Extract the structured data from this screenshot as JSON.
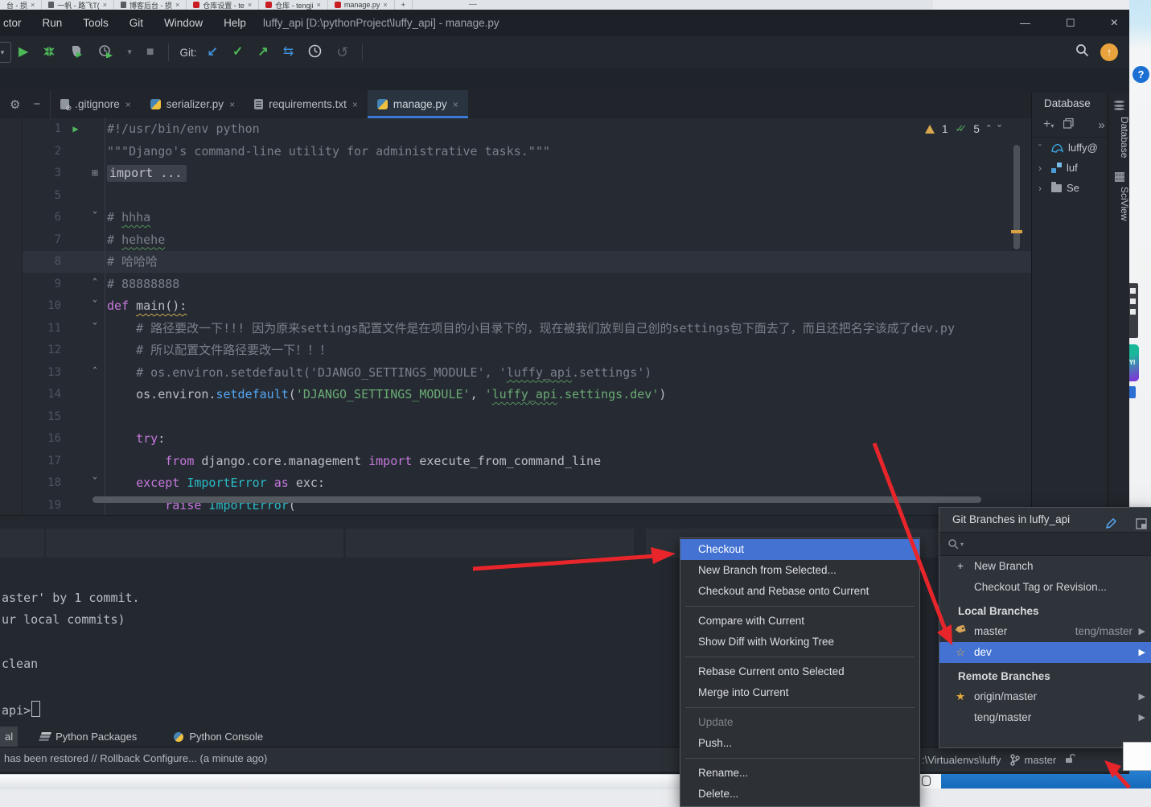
{
  "colors": {
    "selection_blue": "#4372d3",
    "arrow_red": "#e8252a",
    "editor_bg": "#262b33",
    "keyword": "#c678dd",
    "string": "#6aab73",
    "method": "#56a8f5",
    "class": "#2bbac5",
    "comment": "#7a8089",
    "tab_underline": "#3c78d8",
    "gitee_red": "#c71d23"
  },
  "browser": {
    "tabs": [
      {
        "label": "台 - 损",
        "icon": "none"
      },
      {
        "label": "一帆 - 路飞T(",
        "icon": "dark"
      },
      {
        "label": "博客后台 - 损",
        "icon": "dark"
      },
      {
        "label": "仓库设置 - te",
        "icon": "gitee"
      },
      {
        "label": "仓库 - tengji",
        "icon": "gitee"
      },
      {
        "label": "manage.py",
        "icon": "gitee"
      }
    ],
    "close_glyph": "×",
    "new_tab_glyph": "+",
    "minimize_glyph": "—"
  },
  "title_bar": {
    "menus": [
      "ctor",
      "Run",
      "Tools",
      "Git",
      "Window",
      "Help"
    ],
    "title": "luffy_api [D:\\pythonProject\\luffy_api] - manage.py",
    "controls": {
      "minimize": "—",
      "maximize": "☐",
      "close": "×"
    }
  },
  "toolbar": {
    "git_label": "Git:",
    "run_config_caret": "▾",
    "play": "▶",
    "dropdown": "▾",
    "stop": "■",
    "update": "↙",
    "commit": "✓",
    "push": "↗",
    "compare": "⇆",
    "rollback": "↺",
    "up_arrow": "↑"
  },
  "editor": {
    "tabs": [
      {
        "label": ".gitignore",
        "icon": "doc-slash"
      },
      {
        "label": "serializer.py",
        "icon": "python"
      },
      {
        "label": "requirements.txt",
        "icon": "doc-txt"
      },
      {
        "label": "manage.py",
        "icon": "python"
      }
    ],
    "active_tab": "manage.py",
    "inspections": {
      "warnings": "1",
      "typos": "5",
      "prev": "ˆ",
      "next": "ˇ"
    },
    "lines": [
      {
        "n": "1",
        "g": "run",
        "t": [
          [
            "c",
            "#!/usr/bin/env python"
          ]
        ]
      },
      {
        "n": "2",
        "g": "",
        "t": [
          [
            "c",
            "\"\"\"Django's command-line utility for administrative tasks.\"\"\""
          ]
        ]
      },
      {
        "n": "3",
        "g": "plus",
        "t": [
          [
            "f",
            "import ..."
          ]
        ]
      },
      {
        "n": "5",
        "g": "",
        "t": []
      },
      {
        "n": "6",
        "g": "fo",
        "t": [
          [
            "c",
            "# "
          ],
          [
            "c wg",
            "hhha"
          ]
        ]
      },
      {
        "n": "7",
        "g": "",
        "t": [
          [
            "c",
            "# "
          ],
          [
            "c wg",
            "hehehe"
          ]
        ]
      },
      {
        "n": "8",
        "g": "",
        "cur": true,
        "t": [
          [
            "c",
            "# 哈哈哈"
          ]
        ]
      },
      {
        "n": "9",
        "g": "fe",
        "t": [
          [
            "c",
            "# 88888888"
          ]
        ]
      },
      {
        "n": "10",
        "g": "fo",
        "t": [
          [
            "k",
            "def "
          ],
          [
            "p wy",
            "main():"
          ]
        ]
      },
      {
        "n": "11",
        "g": "fo",
        "t": [
          [
            "c",
            "    # 路径要改一下!!! 因为原来settings配置文件是在项目的小目录下的，现在被我们放到自己创的settings包下面去了，而且还把名字该成了dev.py"
          ]
        ]
      },
      {
        "n": "12",
        "g": "",
        "t": [
          [
            "c",
            "    # 所以配置文件路径要改一下！！！"
          ]
        ]
      },
      {
        "n": "13",
        "g": "fe",
        "t": [
          [
            "c",
            "    # os.environ.setdefault('DJANGO_SETTINGS_MODULE', '"
          ],
          [
            "c wg",
            "luffy_api"
          ],
          [
            "c",
            ".settings')"
          ]
        ]
      },
      {
        "n": "14",
        "g": "",
        "t": [
          [
            "p",
            "    os.environ."
          ],
          [
            "m",
            "setdefault"
          ],
          [
            "p",
            "("
          ],
          [
            "s",
            "'DJANGO_SETTINGS_MODULE'"
          ],
          [
            "p",
            ", "
          ],
          [
            "s",
            "'"
          ],
          [
            "s wg",
            "luffy_api"
          ],
          [
            "s",
            ".settings.dev'"
          ],
          [
            "p",
            ")"
          ]
        ]
      },
      {
        "n": "15",
        "g": "",
        "t": []
      },
      {
        "n": "16",
        "g": "",
        "t": [
          [
            "k",
            "    try"
          ],
          [
            "p",
            ":"
          ]
        ]
      },
      {
        "n": "17",
        "g": "",
        "t": [
          [
            "k",
            "        from "
          ],
          [
            "p",
            "django.core.management "
          ],
          [
            "k",
            "import "
          ],
          [
            "p",
            "execute_from_command_line"
          ]
        ]
      },
      {
        "n": "18",
        "g": "fo",
        "t": [
          [
            "k",
            "    except "
          ],
          [
            "cl",
            "ImportError "
          ],
          [
            "k",
            "as "
          ],
          [
            "p",
            "exc:"
          ]
        ]
      },
      {
        "n": "19",
        "g": "",
        "t": [
          [
            "k",
            "        raise "
          ],
          [
            "cl",
            "ImportError"
          ],
          [
            "p",
            "("
          ]
        ]
      }
    ]
  },
  "database": {
    "title": "Database",
    "toolbar": {
      "add": "+",
      "caret": "▾",
      "more": "»"
    },
    "tree": [
      {
        "label": "luffy@",
        "icon": "mysql",
        "chevron": "expanded"
      },
      {
        "label": "luf",
        "icon": "schema",
        "chevron": "collapsed"
      },
      {
        "label": "Se",
        "icon": "folder",
        "chevron": "collapsed"
      }
    ]
  },
  "stripe_labels": {
    "database": "Database",
    "sciview": "SciView"
  },
  "terminal": {
    "lines": [
      "aster' by 1 commit.",
      "ur local commits)",
      "clean",
      "api>"
    ]
  },
  "bottom_tabs": [
    {
      "label": "al",
      "icon": "terminal",
      "selected": true
    },
    {
      "label": "Python Packages",
      "icon": "layers",
      "selected": false
    },
    {
      "label": "Python Console",
      "icon": "python",
      "selected": false
    }
  ],
  "status_bar": {
    "left": "has been restored // Rollback   Configure... (a minute ago)",
    "path": ":\\Virtualenvs\\luffy",
    "branch": "master"
  },
  "git_popup": {
    "title": "Git Branches in luffy_api",
    "rows": [
      {
        "t": "action",
        "icon": "plus",
        "label": "New Branch"
      },
      {
        "t": "action",
        "icon": "",
        "label": "Checkout Tag or Revision..."
      },
      {
        "t": "header",
        "label": "Local Branches"
      },
      {
        "t": "branch",
        "icon": "tag",
        "label": "master",
        "right": "teng/master",
        "arrow": true
      },
      {
        "t": "branch",
        "icon": "star-o",
        "label": "dev",
        "sel": true,
        "arrow": true
      },
      {
        "t": "header",
        "label": "Remote Branches"
      },
      {
        "t": "branch",
        "icon": "star",
        "label": "origin/master",
        "arrow": true
      },
      {
        "t": "branch",
        "icon": "",
        "label": "teng/master",
        "arrow": true
      }
    ]
  },
  "context_menu": {
    "items": [
      {
        "label": "Checkout",
        "sel": true
      },
      {
        "label": "New Branch from Selected..."
      },
      {
        "label": "Checkout and Rebase onto Current"
      },
      {
        "sep": true
      },
      {
        "label": "Compare with Current"
      },
      {
        "label": "Show Diff with Working Tree"
      },
      {
        "sep": true
      },
      {
        "label": "Rebase Current onto Selected"
      },
      {
        "label": "Merge into Current"
      },
      {
        "sep": true
      },
      {
        "label": "Update",
        "dis": true
      },
      {
        "label": "Push..."
      },
      {
        "sep": true
      },
      {
        "label": "Rename..."
      },
      {
        "label": "Delete..."
      }
    ]
  },
  "yi_badge": "YI"
}
